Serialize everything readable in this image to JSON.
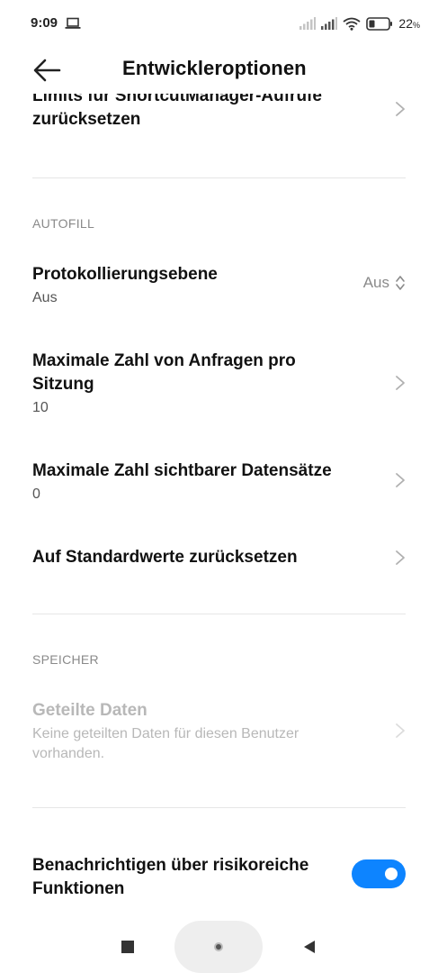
{
  "status_bar": {
    "time": "9:09",
    "battery_value": "22",
    "battery_unit": "%",
    "icons": [
      "laptop-icon",
      "signal-icon",
      "signal-icon",
      "wifi-icon",
      "battery-icon"
    ]
  },
  "header": {
    "back_icon": "arrow-left-icon",
    "title": "Entwickleroptionen"
  },
  "content": {
    "partial_row": {
      "title_line1": "Limits für ShortcutManager-Aufrufe",
      "title_line2": "zurücksetzen"
    },
    "autofill": {
      "section_label": "AUTOFILL",
      "logging": {
        "title": "Protokollierungsebene",
        "subtitle": "Aus",
        "value": "Aus"
      },
      "max_requests": {
        "title_line1": "Maximale Zahl von Anfragen pro",
        "title_line2": "Sitzung",
        "subtitle": "10"
      },
      "max_visible": {
        "title": "Maximale Zahl sichtbarer Datensätze",
        "subtitle": "0"
      },
      "reset": {
        "title": "Auf Standardwerte zurücksetzen"
      }
    },
    "storage": {
      "section_label": "SPEICHER",
      "shared_data": {
        "title": "Geteilte Daten",
        "subtitle_line1": "Keine geteilten Daten für diesen Benutzer",
        "subtitle_line2": "vorhanden.",
        "enabled": false
      }
    },
    "risky_features": {
      "title_line1": "Benachrichtigen über risikoreiche",
      "title_line2": "Funktionen",
      "toggle_on": true
    }
  },
  "nav_bar": {
    "icons": [
      "recents-square-icon",
      "home-pill-icon",
      "back-triangle-icon"
    ]
  },
  "colors": {
    "accent": "#0d84ff",
    "text_primary": "#111111",
    "text_secondary": "#555555",
    "text_muted": "#8a8a8a",
    "text_disabled": "#b8b8b8",
    "divider": "#e6e6e6"
  }
}
